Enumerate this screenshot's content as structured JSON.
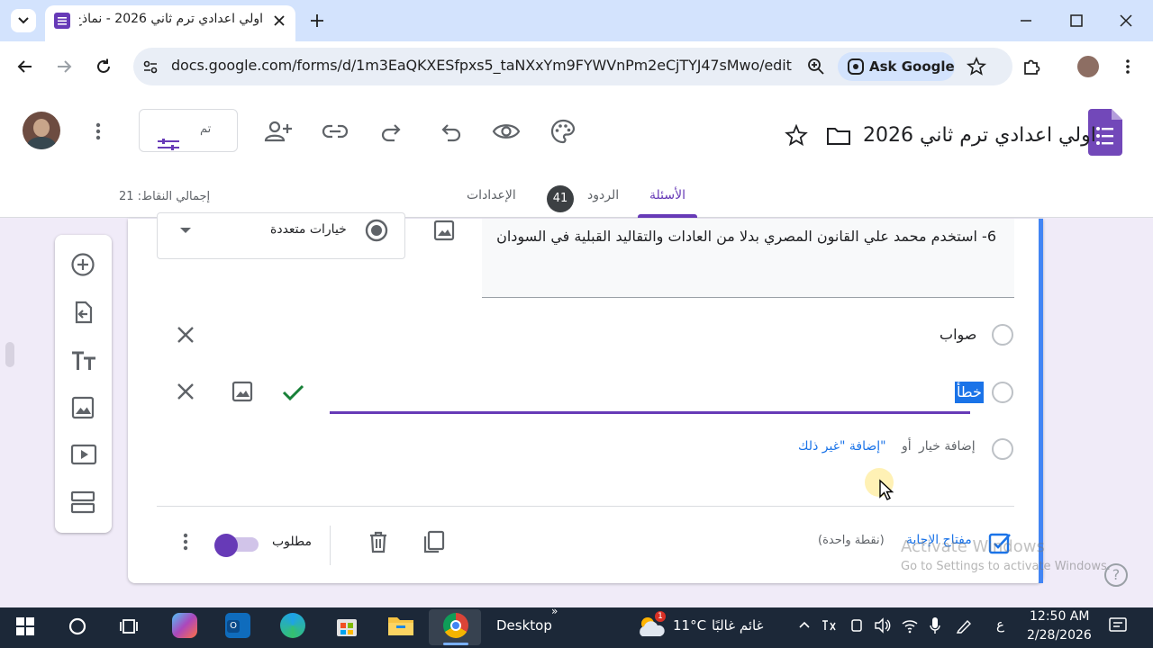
{
  "browser": {
    "tab_title": "اولي اعدادي ترم ثاني 2026 - نماذج",
    "url": "docs.google.com/forms/d/1m3EaQKXESfpxs5_taNXxYm9FYWVnPm2eCjTYJ47sMwo/edit",
    "ask_google": "Ask Google"
  },
  "form": {
    "title": "اولي اعدادي ترم ثاني 2026",
    "theme_box_label": "تم",
    "tabs": {
      "questions": "الأسئلة",
      "responses": "الردود",
      "responses_count": "41",
      "settings": "الإعدادات"
    },
    "total_points": "إجمالي النقاط: 21"
  },
  "question": {
    "text": "6- استخدم محمد علي القانون المصري بدلا من العادات والتقاليد القبلية في السودان",
    "type": "خيارات متعددة",
    "options": [
      "صواب",
      "خطأ"
    ],
    "add_option": "إضافة خيار",
    "or": "أو",
    "add_other": "إضافة \"غير ذلك\"",
    "answer_key": "مفتاح الإجابة",
    "points": "(نقطة واحدة)",
    "required": "مطلوب"
  },
  "watermark": {
    "line1": "Activate Windows",
    "line2": "Go to Settings to activate Windows."
  },
  "taskbar": {
    "desktop": "Desktop",
    "weather_temp": "11°C",
    "weather_text": "غائم غالبًا",
    "weather_badge": "1",
    "lang": "ع",
    "time": "12:50 AM",
    "date": "2/28/2026"
  },
  "colors": {
    "accent": "#673ab7",
    "link": "#1a73e8",
    "card_left_bar": "#4285f4",
    "correct_check": "#188038"
  }
}
